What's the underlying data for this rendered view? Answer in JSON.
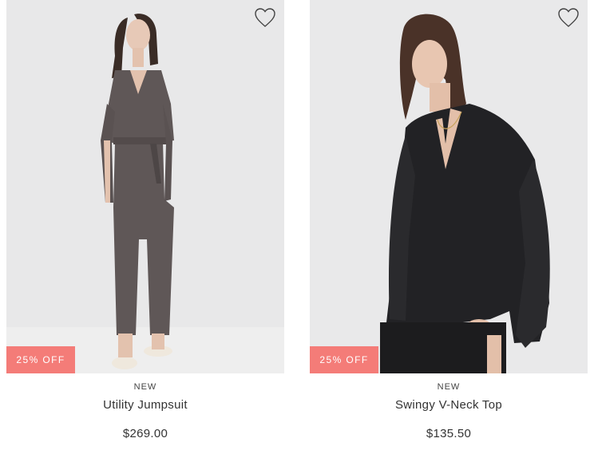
{
  "products": [
    {
      "badge": "25% OFF",
      "tag": "NEW",
      "name": "Utility Jumpsuit",
      "price": "$269.00",
      "icon": "heart-outline-icon"
    },
    {
      "badge": "25% OFF",
      "tag": "NEW",
      "name": "Swingy V-Neck Top",
      "price": "$135.50",
      "icon": "heart-outline-icon"
    }
  ],
  "colors": {
    "badge_bg": "#f47c78",
    "photo_bg": "#e9e9ea",
    "text": "#333333"
  }
}
